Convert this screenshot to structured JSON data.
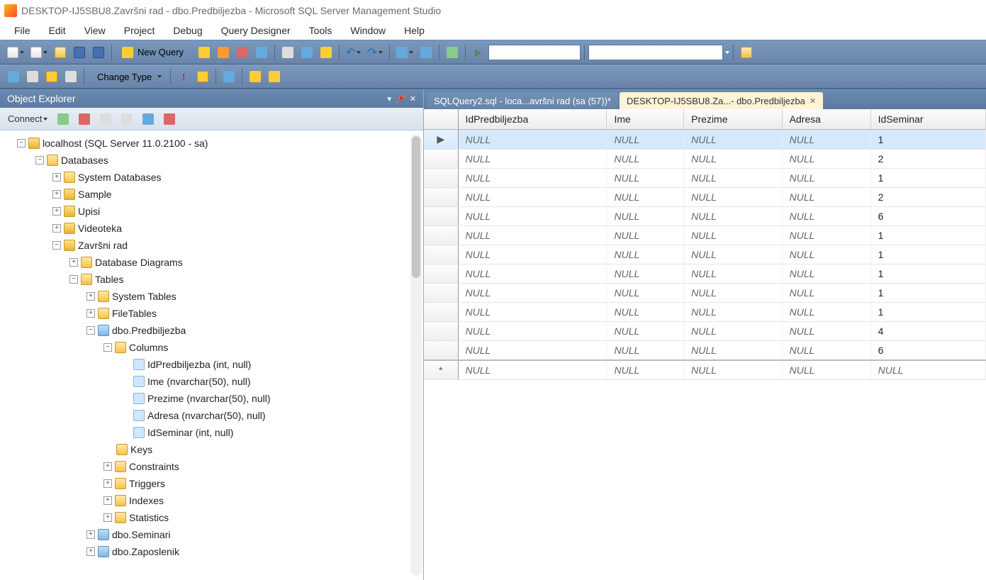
{
  "window": {
    "title": "DESKTOP-IJ5SBU8.Završni rad - dbo.Predbiljezba - Microsoft SQL Server Management Studio"
  },
  "menu": [
    "File",
    "Edit",
    "View",
    "Project",
    "Debug",
    "Query Designer",
    "Tools",
    "Window",
    "Help"
  ],
  "toolbar1": {
    "newQueryLabel": "New Query"
  },
  "toolbar2": {
    "changeTypeLabel": "Change Type"
  },
  "explorer": {
    "title": "Object Explorer",
    "connectLabel": "Connect",
    "root": "localhost (SQL Server 11.0.2100 - sa)",
    "databasesLabel": "Databases",
    "systemDbLabel": "System Databases",
    "dbs": [
      "Sample",
      "Upisi",
      "Videoteka"
    ],
    "activeDb": "Završni rad",
    "diagramsLabel": "Database Diagrams",
    "tablesLabel": "Tables",
    "sysTablesLabel": "System Tables",
    "fileTablesLabel": "FileTables",
    "activeTable": "dbo.Predbiljezba",
    "columnsLabel": "Columns",
    "columns": [
      "IdPredbiljezba (int, null)",
      "Ime (nvarchar(50), null)",
      "Prezime (nvarchar(50), null)",
      "Adresa (nvarchar(50), null)",
      "IdSeminar (int, null)"
    ],
    "keysLabel": "Keys",
    "constraintsLabel": "Constraints",
    "triggersLabel": "Triggers",
    "indexesLabel": "Indexes",
    "statisticsLabel": "Statistics",
    "otherTables": [
      "dbo.Seminari",
      "dbo.Zaposlenik"
    ]
  },
  "tabsArea": {
    "tab1": "SQLQuery2.sql - loca...avršni rad (sa (57))*",
    "tab2": "DESKTOP-IJ5SBU8.Za...- dbo.Predbiljezba"
  },
  "grid": {
    "headers": [
      "IdPredbiljezba",
      "Ime",
      "Prezime",
      "Adresa",
      "IdSeminar"
    ],
    "nullText": "NULL",
    "rows": [
      {
        "selector": "▶",
        "cells": [
          "NULL",
          "NULL",
          "NULL",
          "NULL",
          "1"
        ],
        "selected": true
      },
      {
        "selector": "",
        "cells": [
          "NULL",
          "NULL",
          "NULL",
          "NULL",
          "2"
        ]
      },
      {
        "selector": "",
        "cells": [
          "NULL",
          "NULL",
          "NULL",
          "NULL",
          "1"
        ]
      },
      {
        "selector": "",
        "cells": [
          "NULL",
          "NULL",
          "NULL",
          "NULL",
          "2"
        ]
      },
      {
        "selector": "",
        "cells": [
          "NULL",
          "NULL",
          "NULL",
          "NULL",
          "6"
        ]
      },
      {
        "selector": "",
        "cells": [
          "NULL",
          "NULL",
          "NULL",
          "NULL",
          "1"
        ]
      },
      {
        "selector": "",
        "cells": [
          "NULL",
          "NULL",
          "NULL",
          "NULL",
          "1"
        ]
      },
      {
        "selector": "",
        "cells": [
          "NULL",
          "NULL",
          "NULL",
          "NULL",
          "1"
        ]
      },
      {
        "selector": "",
        "cells": [
          "NULL",
          "NULL",
          "NULL",
          "NULL",
          "1"
        ]
      },
      {
        "selector": "",
        "cells": [
          "NULL",
          "NULL",
          "NULL",
          "NULL",
          "1"
        ]
      },
      {
        "selector": "",
        "cells": [
          "NULL",
          "NULL",
          "NULL",
          "NULL",
          "4"
        ]
      },
      {
        "selector": "",
        "cells": [
          "NULL",
          "NULL",
          "NULL",
          "NULL",
          "6"
        ]
      },
      {
        "selector": "*",
        "cells": [
          "NULL",
          "NULL",
          "NULL",
          "NULL",
          "NULL"
        ],
        "newrow": true
      }
    ]
  }
}
